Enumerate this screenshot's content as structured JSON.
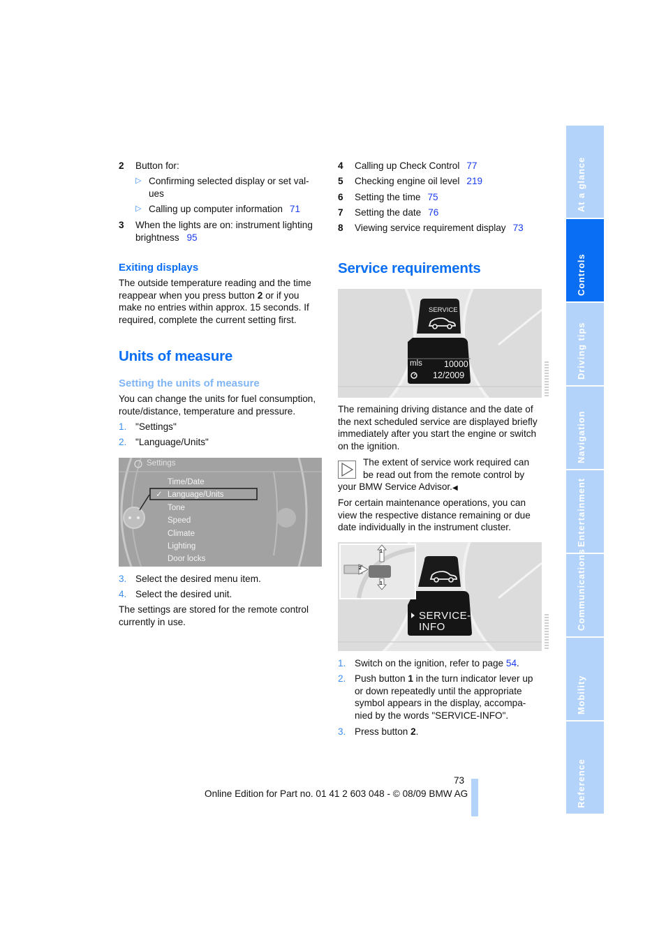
{
  "left_column": {
    "list_top": [
      {
        "num": "2",
        "text": "Button for:"
      },
      {
        "num": "3",
        "text_line1": "When the lights are on: instrument lighting",
        "text_line2": "brightness",
        "page": "95"
      }
    ],
    "sub_bullets": [
      {
        "text_line1": "Confirming selected display or set val-",
        "text_line2": "ues"
      },
      {
        "text": "Calling up computer information",
        "page": "71"
      }
    ],
    "exiting": {
      "heading": "Exiting displays",
      "lines": [
        "The outside temperature reading and the time",
        "reappear when you press button ",
        " or if you",
        "make no entries within approx. 15 seconds. If",
        "required, complete the current setting first."
      ],
      "button_ref": "2"
    },
    "units": {
      "heading": "Units of measure",
      "subheading": "Setting the units of measure",
      "intro_lines": [
        "You can change the units for fuel consumption,",
        "route/distance, temperature and pressure."
      ],
      "steps_a": [
        {
          "num": "1.",
          "text": "\"Settings\""
        },
        {
          "num": "2.",
          "text": "\"Language/Units\""
        }
      ],
      "screen": {
        "title": "Settings",
        "items": [
          "Time/Date",
          "Language/Units",
          "Tone",
          "Speed",
          "Climate",
          "Lighting",
          "Door locks"
        ],
        "selected": "Language/Units",
        "check": "✓"
      },
      "steps_b": [
        {
          "num": "3.",
          "text": "Select the desired menu item."
        },
        {
          "num": "4.",
          "text": "Select the desired unit."
        }
      ],
      "outro_lines": [
        "The settings are stored for the remote control",
        "currently in use."
      ]
    }
  },
  "right_column": {
    "list_top": [
      {
        "num": "4",
        "text": "Calling up Check Control",
        "page": "77"
      },
      {
        "num": "5",
        "text": "Checking engine oil level",
        "page": "219"
      },
      {
        "num": "6",
        "text": "Setting the time",
        "page": "75"
      },
      {
        "num": "7",
        "text": "Setting the date",
        "page": "76"
      },
      {
        "num": "8",
        "text": "Viewing service requirement display",
        "page": "73"
      }
    ],
    "service": {
      "heading": "Service requirements",
      "display1": {
        "label": "SERVICE",
        "unit": "mls",
        "distance": "10000",
        "date": "12/2009"
      },
      "para1_lines": [
        "The remaining driving distance and the date of",
        "the next scheduled service are displayed briefly",
        "immediately after you start the engine or switch",
        "on the ignition."
      ],
      "note_lines": [
        "The extent of service work required can",
        "be read out from the remote control by",
        "your BMW Service Advisor."
      ],
      "note_end": "◀",
      "para2_lines": [
        "For certain maintenance operations, you can",
        "view the respective distance remaining or due",
        "date individually in the instrument cluster."
      ],
      "display2": {
        "line1": "SERVICE-",
        "line2": "INFO",
        "lever_up": "1",
        "lever_down": "1",
        "lever_button": "2"
      },
      "steps": [
        {
          "num": "1.",
          "lines": [
            "Switch on the ignition, refer to page "
          ],
          "page": "54",
          "tail": "."
        },
        {
          "num": "2.",
          "lines": [
            "Push button ",
            " in the turn indicator lever up",
            "or down repeatedly until the appropriate",
            "symbol appears in the display, accompa-",
            "nied by the words \"SERVICE-INFO\"."
          ],
          "bold": "1"
        },
        {
          "num": "3.",
          "lines": [
            "Press button "
          ],
          "bold": "2",
          "tail": "."
        }
      ]
    }
  },
  "side_tabs": [
    {
      "label": "At a glance",
      "active": false
    },
    {
      "label": "Controls",
      "active": true
    },
    {
      "label": "Driving tips",
      "active": false
    },
    {
      "label": "Navigation",
      "active": false
    },
    {
      "label": "Entertainment",
      "active": false
    },
    {
      "label": "Communications",
      "active": false
    },
    {
      "label": "Mobility",
      "active": false
    },
    {
      "label": "Reference",
      "active": false
    }
  ],
  "footer": {
    "page_number": "73",
    "edition": "Online Edition for Part no. 01 41 2 603 048 - © 08/09 BMW AG"
  },
  "colors": {
    "heading": "#0a6ef5",
    "subheading_light": "#7fb5f5",
    "link": "#1a3cf0",
    "tab": "#b3d3fa",
    "tab_active": "#0a6ef5"
  }
}
